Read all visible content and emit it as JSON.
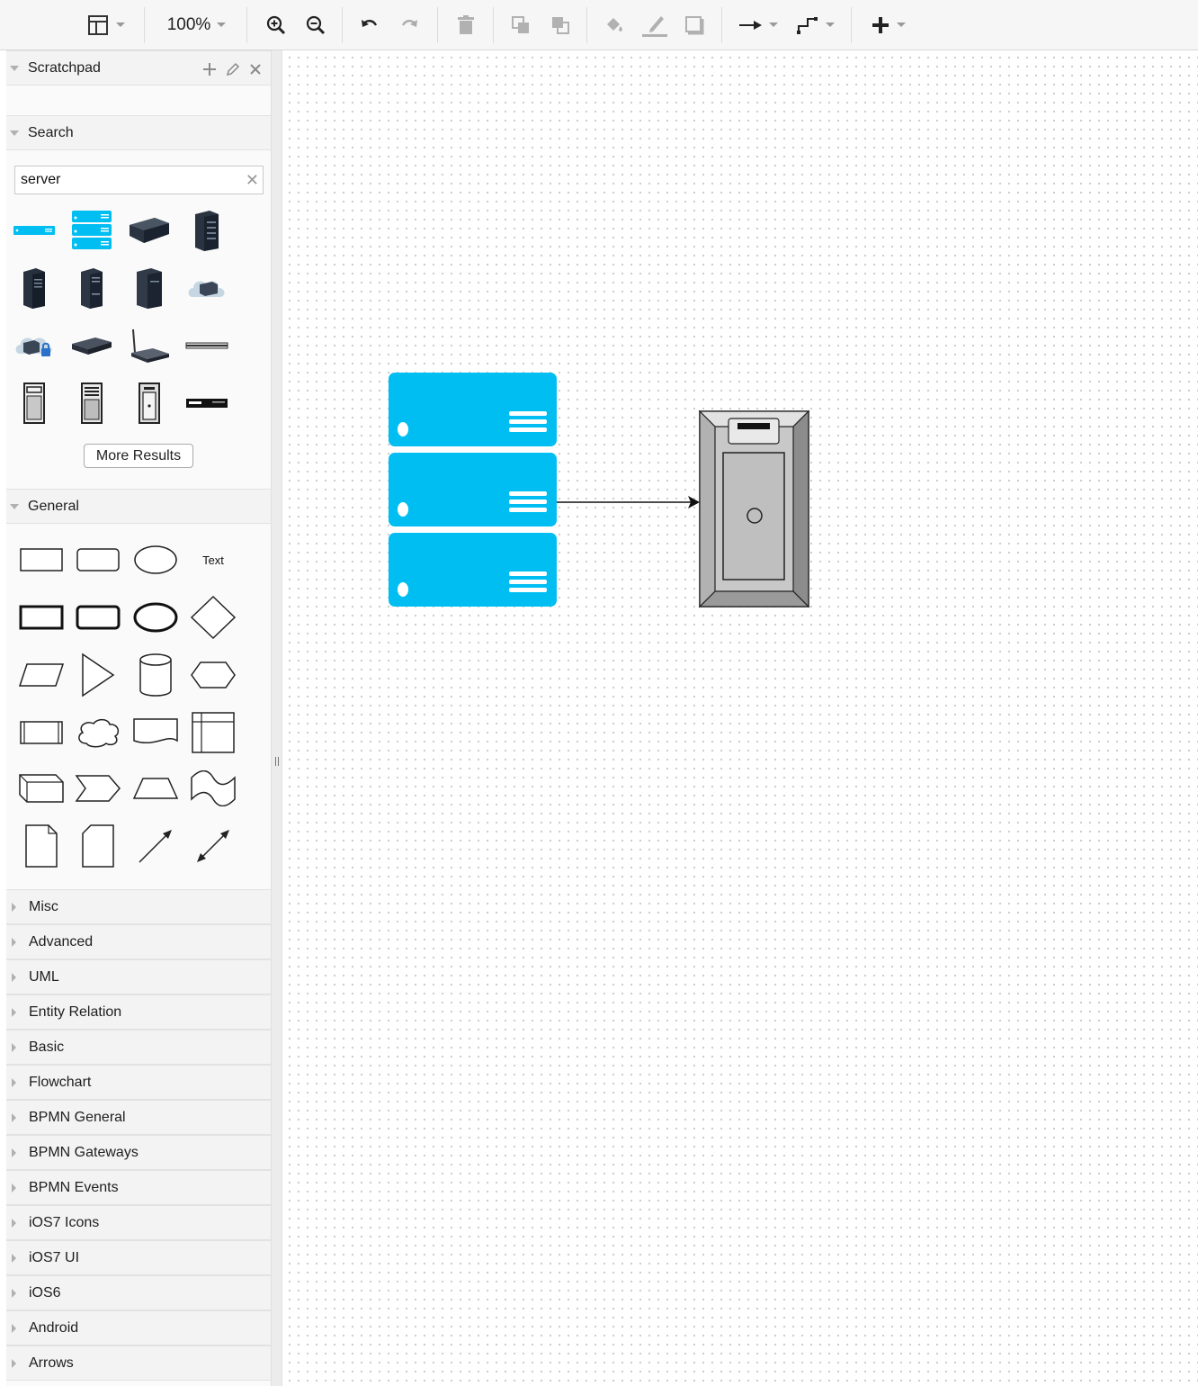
{
  "toolbar": {
    "zoom": "100%",
    "buttons": [
      "format-panel-icon",
      "zoom-in-icon",
      "zoom-out-icon",
      "undo-icon",
      "redo-icon",
      "delete-icon",
      "to-front-icon",
      "to-back-icon",
      "fill-color-icon",
      "line-color-icon",
      "shadow-icon",
      "connection-arrow-icon",
      "waypoints-icon",
      "insert-plus-icon"
    ]
  },
  "sidebar": {
    "scratchpad": {
      "title": "Scratchpad"
    },
    "search": {
      "title": "Search",
      "value": "server",
      "results": [
        "rack-server-1u-icon",
        "rack-server-stack-icon",
        "server-blade-icon",
        "server-tower-dark-icon",
        "server-tower-1-icon",
        "server-tower-2-icon",
        "server-tower-3-icon",
        "cloud-server-icon",
        "cloud-server-lock-icon",
        "network-appliance-icon",
        "wireless-router-icon",
        "rack-unit-thin-icon",
        "pc-tower-icon",
        "mainframe-icon",
        "tower-server-outline-icon",
        "rack-unit-dark-icon"
      ],
      "more_label": "More Results"
    },
    "general": {
      "title": "General",
      "text_label": "Text"
    },
    "collapsed_sections": [
      "Misc",
      "Advanced",
      "UML",
      "Entity Relation",
      "Basic",
      "Flowchart",
      "BPMN General",
      "BPMN Gateways",
      "BPMN Events",
      "iOS7 Icons",
      "iOS7 UI",
      "iOS6",
      "Android",
      "Arrows"
    ]
  },
  "canvas": {
    "shapes": [
      "server-stack-shape",
      "tower-server-shape",
      "connector-arrow"
    ],
    "colors": {
      "server_blue": "#00bef2",
      "tower_gray": "#c0c0c0"
    }
  }
}
